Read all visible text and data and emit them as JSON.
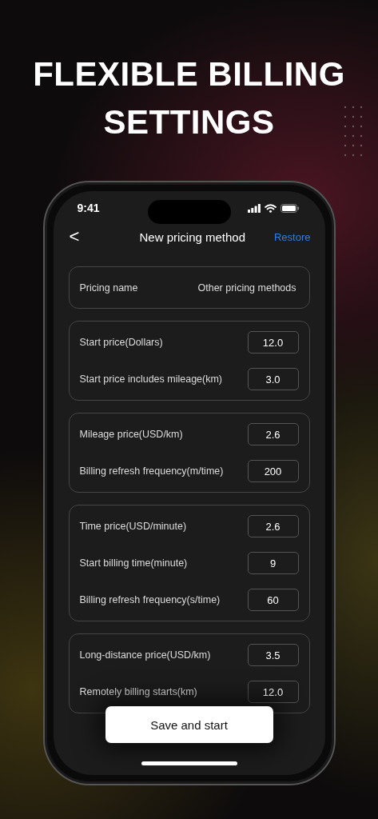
{
  "headline": [
    "FLEXIBLE BILLING",
    "SETTINGS"
  ],
  "status_bar": {
    "time": "9:41"
  },
  "nav": {
    "back": "<",
    "title": "New pricing method",
    "action": "Restore"
  },
  "name_card": {
    "label": "Pricing name",
    "value": "Other pricing methods"
  },
  "groups": [
    {
      "rows": [
        {
          "label": "Start price(Dollars)",
          "value": "12.0"
        },
        {
          "label": "Start price includes mileage(km)",
          "value": "3.0"
        }
      ]
    },
    {
      "rows": [
        {
          "label": "Mileage price(USD/km)",
          "value": "2.6"
        },
        {
          "label": "Billing refresh frequency(m/time)",
          "value": "200"
        }
      ]
    },
    {
      "rows": [
        {
          "label": "Time price(USD/minute)",
          "value": "2.6"
        },
        {
          "label": "Start billing time(minute)",
          "value": "9"
        },
        {
          "label": "Billing refresh frequency(s/time)",
          "value": "60"
        }
      ]
    },
    {
      "rows": [
        {
          "label": "Long-distance price(USD/km)",
          "value": "3.5"
        },
        {
          "label": "Remotely billing starts(km)",
          "value": "12.0"
        }
      ]
    }
  ],
  "save_button": "Save and start"
}
